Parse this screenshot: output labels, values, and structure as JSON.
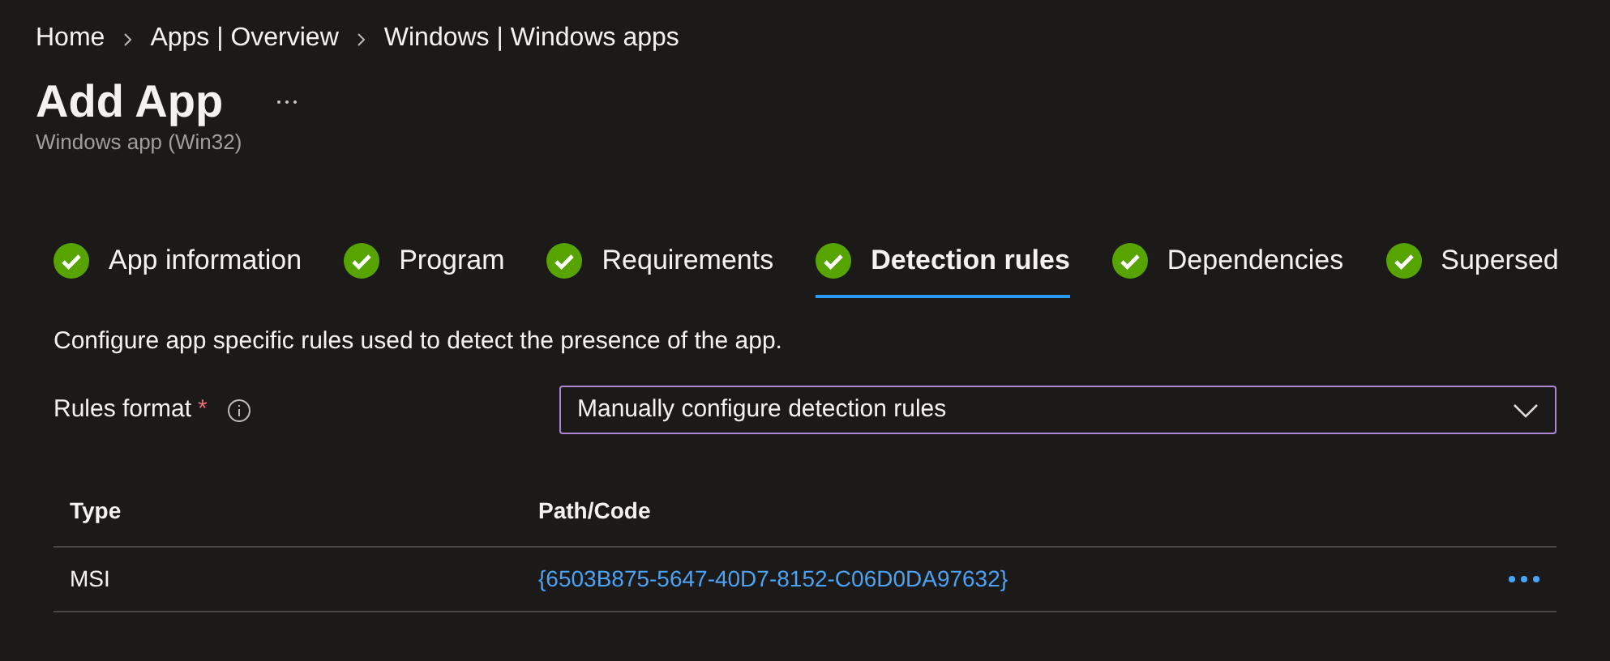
{
  "breadcrumb": [
    "Home",
    "Apps | Overview",
    "Windows | Windows apps"
  ],
  "page": {
    "title": "Add App",
    "subtitle": "Windows app (Win32)"
  },
  "tabs": [
    {
      "label": "App information",
      "selected": false,
      "complete": true
    },
    {
      "label": "Program",
      "selected": false,
      "complete": true
    },
    {
      "label": "Requirements",
      "selected": false,
      "complete": true
    },
    {
      "label": "Detection rules",
      "selected": true,
      "complete": true
    },
    {
      "label": "Dependencies",
      "selected": false,
      "complete": true
    },
    {
      "label": "Supersed",
      "selected": false,
      "complete": true
    }
  ],
  "description": "Configure app specific rules used to detect the presence of the app.",
  "rules_format": {
    "label": "Rules format",
    "required_mark": "*",
    "value": "Manually configure detection rules"
  },
  "table": {
    "columns": [
      "Type",
      "Path/Code"
    ],
    "rows": [
      {
        "type": "MSI",
        "path_code": "{6503B875-5647-40D7-8152-C06D0DA97632}"
      }
    ]
  }
}
